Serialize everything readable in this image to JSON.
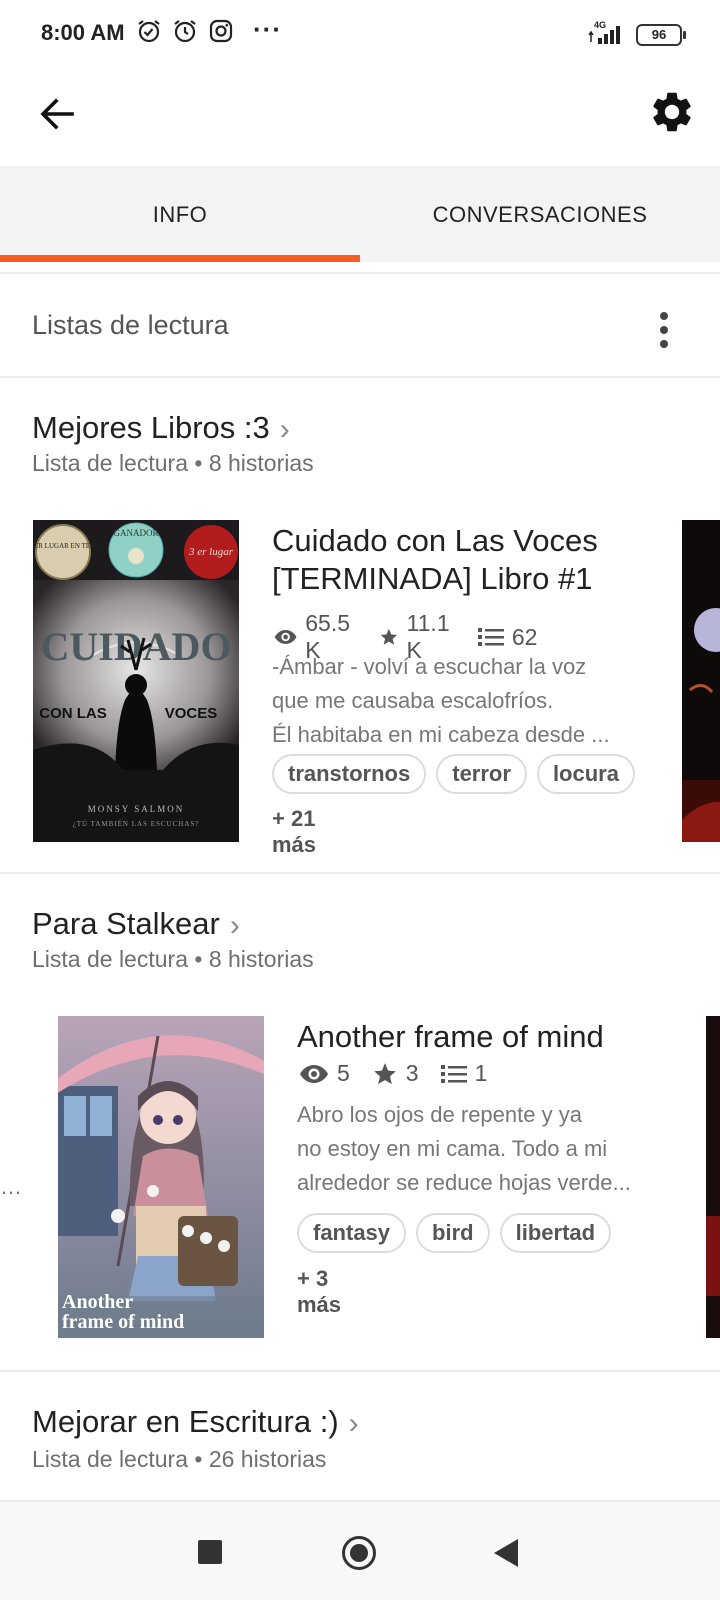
{
  "status_bar": {
    "time": "8:00 AM",
    "network": "4G",
    "battery": "96",
    "icons": [
      "alarm-check-icon",
      "alarm-icon",
      "instagram-icon",
      "more-dots-icon",
      "signal-icon",
      "battery-icon"
    ],
    "dots": "···"
  },
  "toolbar": {
    "back_icon": "arrow-left-icon",
    "settings_icon": "gear-icon"
  },
  "tabs": [
    {
      "label": "INFO",
      "active": true
    },
    {
      "label": "CONVERSACIONES",
      "active": false
    }
  ],
  "colors": {
    "accent": "#ff5a1f"
  },
  "section": {
    "title": "Listas de lectura",
    "menu_icon": "kebab-menu-icon"
  },
  "lists": [
    {
      "name": "Mejores Libros :3",
      "subtitle": "Lista de lectura • 8 historias",
      "story": {
        "title_line1": "Cuidado con Las Voces",
        "title_line2": "[TERMINADA] Libro #1",
        "reads": "65.5 K",
        "votes": "11.1 K",
        "parts": "62",
        "desc": [
          "-Ámbar - volví a escuchar la voz",
          "que me causaba escalofríos.",
          "Él habitaba en mi cabeza desde ..."
        ],
        "tags": [
          "transtornos",
          "terror",
          "locura"
        ],
        "more": "+ 21 más",
        "cover": {
          "badge1": "PRIMER LUGAR EN TERROR",
          "badge2": "GANADOR",
          "badge3": "3 er lugar",
          "title1": "CUIDADO",
          "title2": "CON LAS",
          "title3": "VOCES",
          "author": "MONSY SALMON",
          "tagline": "¿TÚ TAMBIÉN LAS ESCUCHAS?"
        }
      }
    },
    {
      "name": "Para Stalkear",
      "subtitle": "Lista de lectura • 8 historias",
      "story": {
        "title": "Another frame of mind",
        "reads": "5",
        "votes": "3",
        "parts": "1",
        "desc": [
          "Abro los ojos de repente y ya",
          "no estoy en mi cama. Todo a mi",
          "alrededor se reduce hojas verde..."
        ],
        "tags": [
          "fantasy",
          "bird",
          "libertad"
        ],
        "more": "+ 3 más",
        "cover": {
          "title1": "Another",
          "title2": "frame of mind"
        }
      }
    },
    {
      "name": "Mejorar en Escritura :)",
      "subtitle": "Lista de lectura • 26 historias"
    }
  ],
  "navbar": {
    "recents_icon": "square-icon",
    "home_icon": "circle-home-icon",
    "back_icon": "triangle-back-icon"
  }
}
